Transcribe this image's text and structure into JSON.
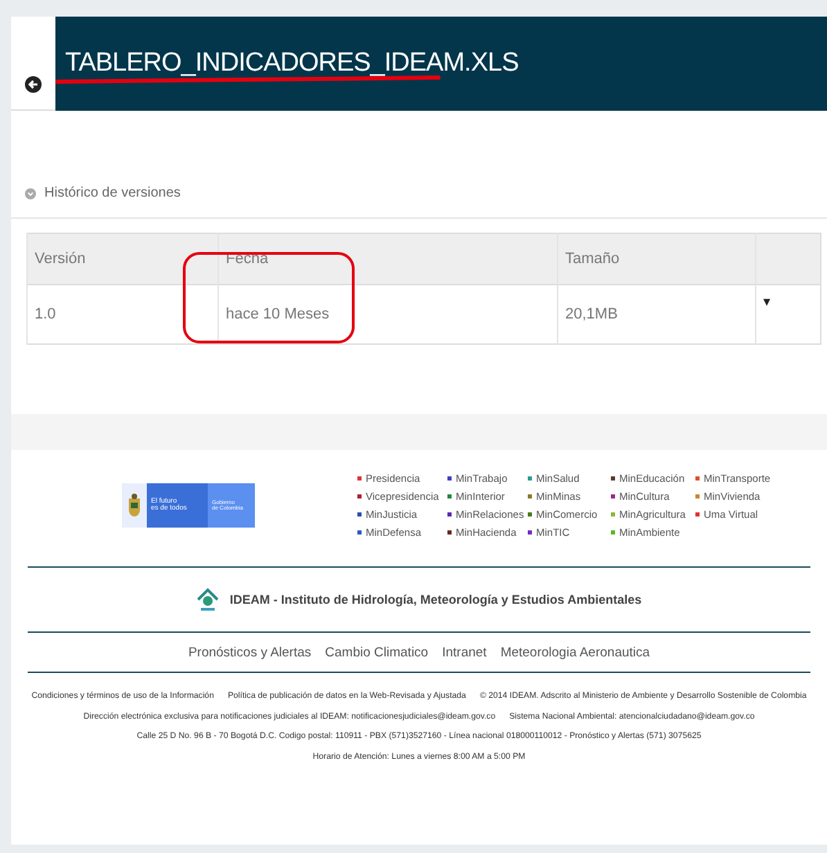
{
  "header": {
    "title": "TABLERO_INDICADORES_IDEAM.XLS"
  },
  "versions": {
    "heading": "Histórico de versiones",
    "columns": [
      "Versión",
      "Fecha",
      "Tamaño"
    ],
    "rows": [
      {
        "version": "1.0",
        "date": "hace 10 Meses",
        "size": "20,1MB",
        "menu": "▾"
      }
    ]
  },
  "footer": {
    "logo": {
      "line_1": "El futuro",
      "line_2": "es de todos",
      "line_3": "Gobierno",
      "line_4": "de Colombia"
    },
    "entities": [
      {
        "label": "Presidencia",
        "color": "#d9383a"
      },
      {
        "label": "MinTrabajo",
        "color": "#3f3fbf"
      },
      {
        "label": "MinSalud",
        "color": "#2a9d8f"
      },
      {
        "label": "MinEducación",
        "color": "#5a3a2e"
      },
      {
        "label": "MinTransporte",
        "color": "#d9532b"
      },
      {
        "label": "Vicepresidencia",
        "color": "#b0202a"
      },
      {
        "label": "MinInterior",
        "color": "#1e8a3a"
      },
      {
        "label": "MinMinas",
        "color": "#8a7a2a"
      },
      {
        "label": "MinCultura",
        "color": "#9b2a8a"
      },
      {
        "label": "MinVivienda",
        "color": "#c9862a"
      },
      {
        "label": "MinJusticia",
        "color": "#2a4fb0"
      },
      {
        "label": "MinRelaciones",
        "color": "#5a2ab0"
      },
      {
        "label": "MinComercio",
        "color": "#4a7a1a"
      },
      {
        "label": "MinAgricultura",
        "color": "#8ab83a"
      },
      {
        "label": "Uma Virtual",
        "color": "#e0303a"
      },
      {
        "label": "MinDefensa",
        "color": "#2a5ac0"
      },
      {
        "label": "MinHacienda",
        "color": "#6a2a1a"
      },
      {
        "label": "MinTIC",
        "color": "#7a2ac0"
      },
      {
        "label": "MinAmbiente",
        "color": "#5ab82a"
      }
    ],
    "institute": "IDEAM - Instituto de Hidrología, Meteorología y Estudios Ambientales",
    "links": [
      "Pronósticos y Alertas",
      "Cambio Climatico",
      "Intranet",
      "Meteorologia Aeronautica"
    ],
    "legal": [
      {
        "parts": [
          "Condiciones y términos de uso de la Información",
          "Política de publicación de datos en la Web-Revisada y Ajustada",
          "© 2014 IDEAM. Adscrito al Ministerio de Ambiente y Desarrollo Sostenible de Colombia"
        ]
      },
      {
        "parts": [
          "Dirección electrónica exclusiva para notificaciones judiciales al IDEAM: notificacionesjudiciales@ideam.gov.co",
          "Sistema Nacional Ambiental: atencionalciudadano@ideam.gov.co"
        ]
      },
      {
        "parts": [
          "Calle 25 D No. 96 B - 70 Bogotá D.C. Codigo postal: 110911 - PBX (571)3527160 - Línea nacional 018000110012 - Pronóstico y Alertas (571) 3075625"
        ]
      },
      {
        "parts": [
          "Horario de Atención: Lunes a viernes 8:00 AM a 5:00 PM"
        ]
      }
    ]
  }
}
